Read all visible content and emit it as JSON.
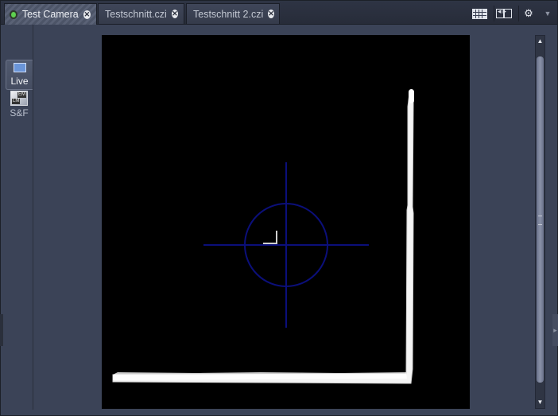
{
  "tabs": [
    {
      "label": "Test Camera",
      "active": true,
      "live_indicator": "green-dot"
    },
    {
      "label": "Testschnitt.czi",
      "active": false
    },
    {
      "label": "Testschnitt 2.czi",
      "active": false
    }
  ],
  "toolbar": {
    "icons": [
      "grid-layout-icon",
      "split-view-icon",
      "gear-icon",
      "dropdown-caret-icon"
    ]
  },
  "side_panel": {
    "live_label": "Live",
    "sf_label": "S&F",
    "sf_icon_badges": [
      "EM",
      "LM"
    ]
  },
  "viewer": {
    "crosshair_color": "#0b0f7a",
    "background": "#000000"
  },
  "colors": {
    "live_dot": "#5ed04f",
    "panel_bg": "#3b4357"
  }
}
